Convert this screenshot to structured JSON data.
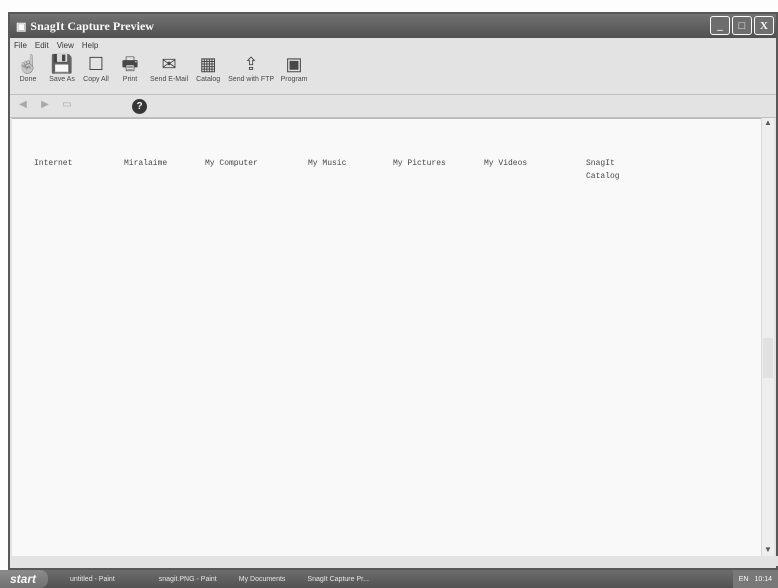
{
  "window": {
    "title": "SnagIt Capture Preview",
    "controls": [
      "_",
      "□",
      "X"
    ]
  },
  "menu": [
    "File",
    "Edit",
    "View",
    "Help"
  ],
  "toolbar": [
    {
      "label": "Done",
      "icon": "☝"
    },
    {
      "label": "Save As",
      "icon": "💾"
    },
    {
      "label": "Copy All",
      "icon": "☐"
    },
    {
      "label": "Print",
      "icon": "🖶"
    },
    {
      "label": "Send E-Mail",
      "icon": "✉"
    },
    {
      "label": "Catalog",
      "icon": "▦"
    },
    {
      "label": "Send with FTP",
      "icon": "⇪"
    },
    {
      "label": "Program",
      "icon": "▣"
    }
  ],
  "help_icon": "?",
  "captured_icons": [
    {
      "label": "Internet"
    },
    {
      "label": "Miralaime"
    },
    {
      "label": "My Computer"
    },
    {
      "label": "My Music"
    },
    {
      "label": "My Pictures"
    },
    {
      "label": "My Videos"
    },
    {
      "label": "SnagIt\nCatalog"
    }
  ],
  "taskbar": {
    "start": "start",
    "tasks": [
      "untitled - Paint",
      "",
      "snagit.PNG - Paint",
      "My Documents",
      "SnagIt Capture Pr..."
    ],
    "tray": {
      "lang": "EN",
      "time": "10:14"
    }
  }
}
